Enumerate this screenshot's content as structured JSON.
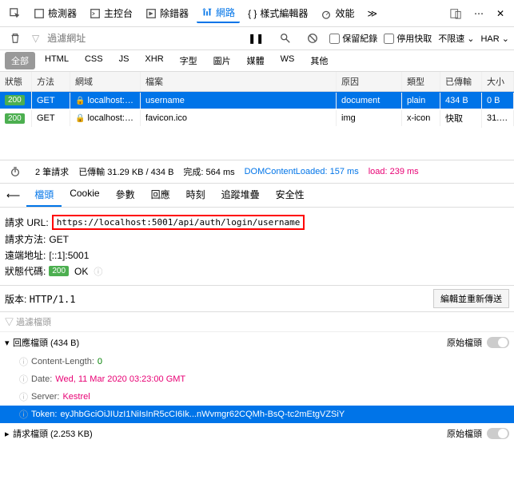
{
  "topTabs": {
    "inspector": "檢測器",
    "console": "主控台",
    "debugger": "除錯器",
    "network": "網路",
    "styleEditor": "樣式編輯器",
    "performance": "效能"
  },
  "filter": {
    "placeholder": "過濾網址",
    "keepLog": "保留紀錄",
    "disableCache": "停用快取",
    "throttle": "不限速",
    "har": "HAR"
  },
  "typeTabs": {
    "all": "全部",
    "html": "HTML",
    "css": "CSS",
    "js": "JS",
    "xhr": "XHR",
    "font": "字型",
    "img": "圖片",
    "media": "媒體",
    "ws": "WS",
    "other": "其他"
  },
  "columns": {
    "status": "狀態",
    "method": "方法",
    "domain": "網域",
    "file": "檔案",
    "cause": "原因",
    "type": "類型",
    "transferred": "已傳輸",
    "size": "大小"
  },
  "rows": [
    {
      "status": "200",
      "method": "GET",
      "domain": "localhost:5...",
      "file": "username",
      "cause": "document",
      "type": "plain",
      "trans": "434 B",
      "size": "0 B",
      "selected": true
    },
    {
      "status": "200",
      "method": "GET",
      "domain": "localhost:5...",
      "file": "favicon.ico",
      "cause": "img",
      "type": "x-icon",
      "trans": "快取",
      "size": "31.2...",
      "selected": false
    }
  ],
  "summary": {
    "requests": "2 筆請求",
    "transferred": "已傳輸 31.29 KB / 434 B",
    "finish": "完成: 564 ms",
    "dom": "DOMContentLoaded: 157 ms",
    "load": "load: 239 ms"
  },
  "detailTabs": {
    "headers": "檔頭",
    "cookies": "Cookie",
    "params": "參數",
    "response": "回應",
    "timings": "時刻",
    "stack": "追蹤堆疊",
    "security": "安全性"
  },
  "details": {
    "urlLabel": "請求 URL:",
    "url": "https://localhost:5001/api/auth/login/username",
    "methodLabel": "請求方法:",
    "method": "GET",
    "remoteLabel": "遠端地址:",
    "remote": "[::1]:5001",
    "statusLabel": "狀態代碼:",
    "statusCode": "200",
    "statusText": "OK",
    "versionLabel": "版本:",
    "version": "HTTP/1.1",
    "editResend": "編輯並重新傳送",
    "filterHeaders": "過濾檔頭"
  },
  "respHeaders": {
    "title": "回應檔頭 (434 B)",
    "raw": "原始檔頭",
    "items": [
      {
        "n": "Content-Length:",
        "v": "0",
        "cls": "hval-green"
      },
      {
        "n": "Date:",
        "v": "Wed, 11 Mar 2020 03:23:00 GMT",
        "cls": "hval-pink"
      },
      {
        "n": "Server:",
        "v": "Kestrel",
        "cls": "hval-pink"
      },
      {
        "n": "Token:",
        "v": "eyJhbGciOiJIUzI1NiIsInR5cCI6Ik...nWvmgr62CQMh-BsQ-tc2mEtgVZSiY",
        "cls": "",
        "selected": true
      }
    ]
  },
  "reqHeaders": {
    "title": "請求檔頭 (2.253 KB)",
    "raw": "原始檔頭"
  }
}
